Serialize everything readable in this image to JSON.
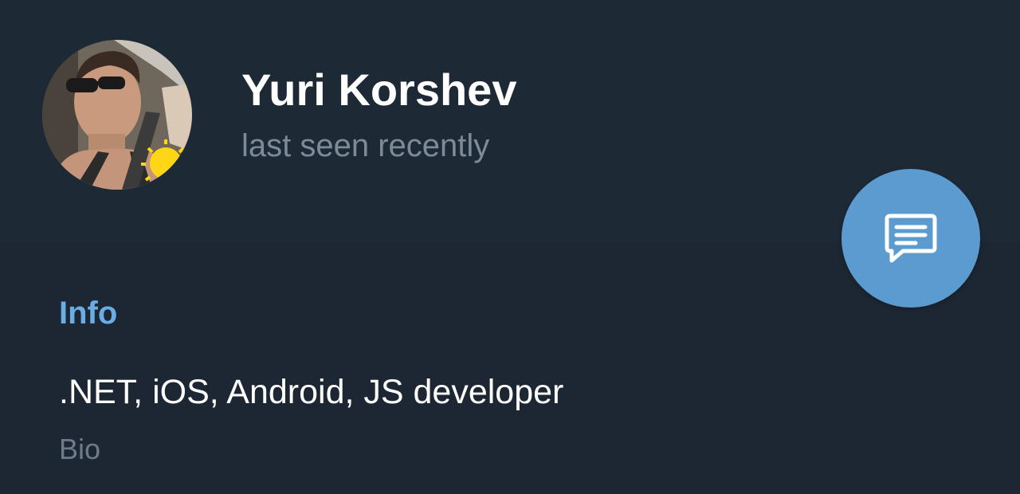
{
  "profile": {
    "name": "Yuri Korshev",
    "status": "last seen recently"
  },
  "info": {
    "section_title": "Info",
    "bio_text": ".NET, iOS, Android, JS developer",
    "bio_label": "Bio"
  },
  "actions": {
    "message_icon": "message-icon"
  },
  "colors": {
    "background": "#1d2733",
    "header_background": "#1e2936",
    "accent": "#6bace4",
    "fab": "#5b9bd0",
    "secondary_text": "#7d8b99"
  }
}
